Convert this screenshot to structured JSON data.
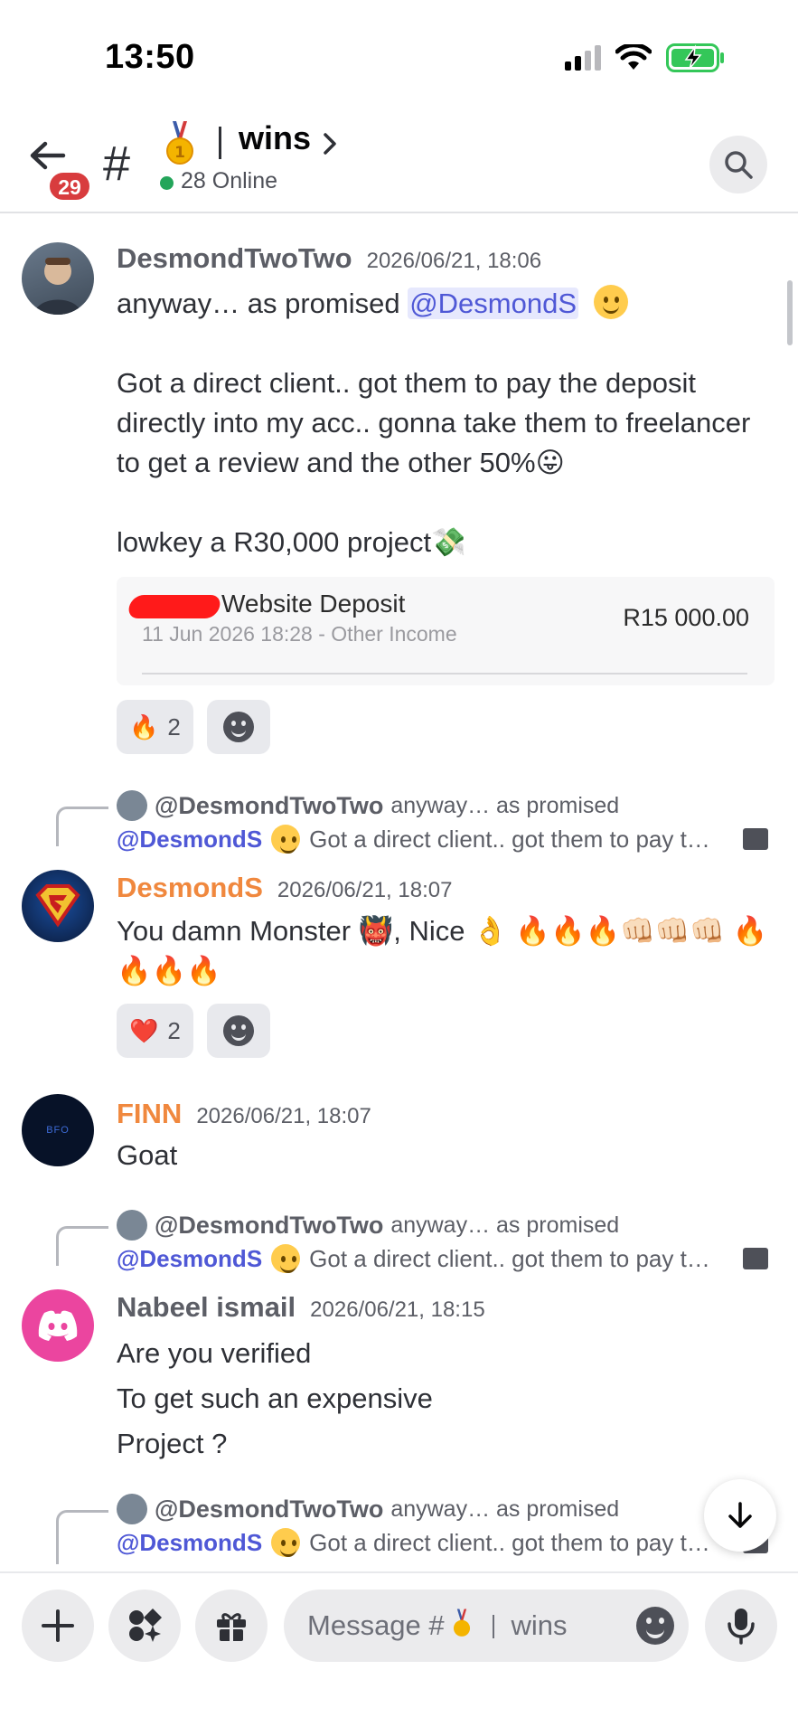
{
  "status_bar": {
    "time": "13:50"
  },
  "header": {
    "back_badge": "29",
    "hash": "#",
    "channel_name": "wins",
    "online": "28 Online",
    "icons": {
      "back": "arrow-left-icon",
      "medal": "gold-medal-icon",
      "chevron": "chevron-right-icon",
      "search": "search-icon"
    }
  },
  "messages": [
    {
      "author": "DesmondTwoTwo",
      "timestamp": "2026/06/21, 18:06",
      "author_color": "#5c5e66",
      "line1_prefix": "anyway… as promised ",
      "mention": "@DesmondS",
      "para2": "Got a direct client.. got them to pay the deposit directly into my acc.. gonna take them to freelancer to get a review and the other 50%😛",
      "para3": "lowkey a R30,000 project💸",
      "attachment": {
        "title": "Website Deposit",
        "subtitle": "11 Jun 2026 18:28 - Other Income",
        "amount": "R15 000.00"
      },
      "reactions": [
        {
          "emoji": "🔥",
          "count": "2"
        }
      ]
    },
    {
      "reply": {
        "author": "@DesmondTwoTwo",
        "snippet": "anyway… as promised",
        "mention": "@DesmondS",
        "text": "Got a direct client.. got them to pay t…"
      },
      "author": "DesmondS",
      "timestamp": "2026/06/21, 18:07",
      "author_color": "#f0883e",
      "text": "You damn Monster 👹, Nice 👌 🔥🔥🔥👊🏻👊🏻👊🏻 🔥🔥🔥🔥",
      "reactions": [
        {
          "emoji": "❤️",
          "count": "2"
        }
      ]
    },
    {
      "author": "FINN",
      "timestamp": "2026/06/21, 18:07",
      "author_color": "#f0883e",
      "text": "Goat",
      "avatar_text": "BFO"
    },
    {
      "reply": {
        "author": "@DesmondTwoTwo",
        "snippet": "anyway… as promised",
        "mention": "@DesmondS",
        "text": "Got a direct client.. got them to pay t…"
      },
      "author": "Nabeel ismail",
      "timestamp": "2026/06/21, 18:15",
      "author_color": "#5c5e66",
      "lines": [
        "Are you verified",
        "To get such an expensive",
        "Project ?"
      ]
    },
    {
      "reply": {
        "author": "@DesmondTwoTwo",
        "snippet": "anyway… as promised",
        "mention": "@DesmondS",
        "text": "Got a direct client.. got them to pay t…"
      }
    }
  ],
  "composer": {
    "placeholder_prefix": "Message #",
    "placeholder_channel": "wins",
    "icons": [
      "plus-icon",
      "apps-icon",
      "gift-icon",
      "emoji-icon",
      "microphone-icon"
    ]
  },
  "colors": {
    "mention": "#4f58d6",
    "orange_name": "#f0883e",
    "online": "#23a55a",
    "badge": "#d83c3e"
  }
}
